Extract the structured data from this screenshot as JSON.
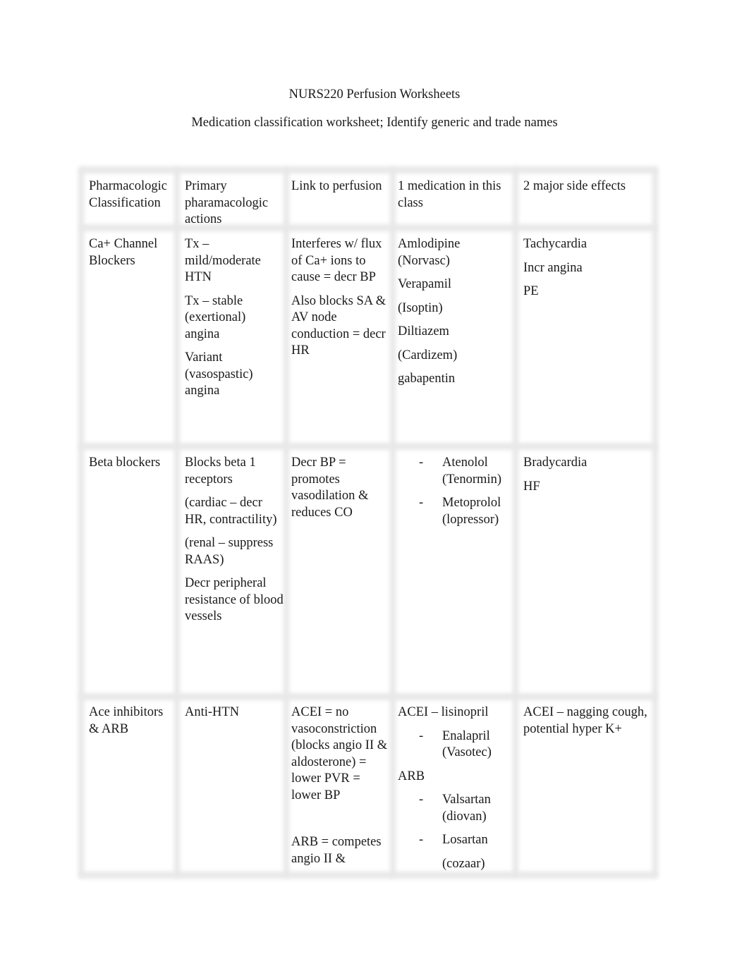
{
  "document": {
    "title": "NURS220 Perfusion Worksheets",
    "subtitle": "Medication classification worksheet; Identify generic and trade names"
  },
  "table": {
    "headers": [
      "Pharmacologic Classification",
      "Primary pharamacologic actions",
      "Link to perfusion",
      "1 medication in this class",
      "2 major side effects"
    ],
    "rows": [
      {
        "classification": "Ca+ Channel Blockers",
        "actions": [
          "Tx – mild/moderate HTN",
          "Tx – stable (exertional) angina",
          "Variant (vasospastic) angina"
        ],
        "perfusion": [
          "Interferes w/ flux of Ca+ ions to cause = decr BP",
          "Also blocks SA & AV node conduction = decr HR"
        ],
        "medications": [
          "Amlodipine (Norvasc)",
          "Verapamil",
          "(Isoptin)",
          "Diltiazem",
          "(Cardizem)",
          "gabapentin"
        ],
        "side_effects": [
          "Tachycardia",
          "Incr angina",
          "PE"
        ]
      },
      {
        "classification": "Beta blockers",
        "actions": [
          "Blocks beta 1 receptors",
          "(cardiac – decr HR, contractility)",
          "(renal – suppress RAAS)",
          "Decr peripheral resistance of blood vessels"
        ],
        "perfusion": [
          "Decr BP = promotes vasodilation & reduces CO"
        ],
        "medications": [
          {
            "bullet": "-",
            "text": "Atenolol (Tenormin)"
          },
          {
            "bullet": "-",
            "text": "Metoprolol (lopressor)"
          }
        ],
        "side_effects": [
          "Bradycardia",
          "HF"
        ]
      },
      {
        "classification": "Ace inhibitors & ARB",
        "actions": [
          "Anti-HTN"
        ],
        "perfusion": [
          "ACEI = no vasoconstriction (blocks angio II & aldosterone) = lower PVR = lower BP",
          "ARB = competes angio II &"
        ],
        "medications": {
          "acei_label": "ACEI – lisinopril",
          "acei_items": [
            {
              "bullet": "-",
              "text": "Enalapril (Vasotec)"
            }
          ],
          "arb_label": "ARB",
          "arb_items": [
            {
              "bullet": "-",
              "text": "Valsartan (diovan)"
            },
            {
              "bullet": "-",
              "text": "Losartan"
            },
            {
              "bullet": "",
              "text": "(cozaar)"
            }
          ]
        },
        "side_effects": [
          "ACEI – nagging cough, potential hyper K+"
        ]
      }
    ]
  }
}
